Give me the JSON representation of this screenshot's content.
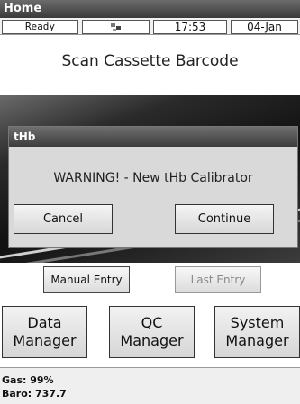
{
  "window": {
    "title": "Home"
  },
  "status": {
    "state": "Ready",
    "network_icon": "network-icon",
    "time": "17:53",
    "date": "04-Jan"
  },
  "main": {
    "instruction": "Scan Cassette Barcode"
  },
  "dialog": {
    "title": "tHb",
    "message": "WARNING! - New tHb Calibrator",
    "cancel_label": "Cancel",
    "continue_label": "Continue"
  },
  "entry": {
    "manual_label": "Manual Entry",
    "last_label": "Last Entry"
  },
  "managers": {
    "data": [
      "Data",
      "Manager"
    ],
    "qc": [
      "QC",
      "Manager"
    ],
    "system": [
      "System",
      "Manager"
    ]
  },
  "footer": {
    "gas": "Gas: 99%",
    "baro": "Baro: 737.7"
  }
}
